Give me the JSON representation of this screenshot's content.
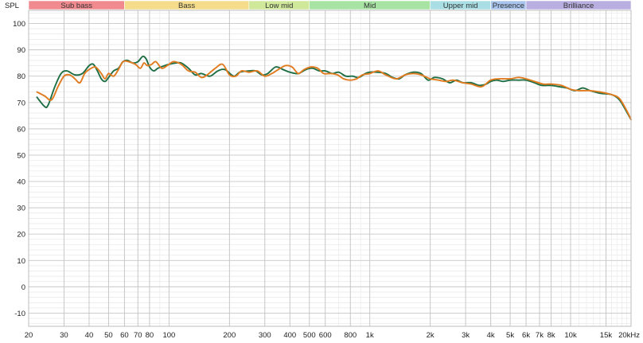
{
  "chart_data": {
    "type": "line",
    "title": "",
    "ylabel": "SPL",
    "xlabel": "",
    "x_unit_suffix": "Hz",
    "x_scale": "log",
    "xlim": [
      20,
      20000
    ],
    "ylim": [
      -15,
      105
    ],
    "grid": true,
    "y_ticks": [
      100,
      90,
      80,
      70,
      60,
      50,
      40,
      30,
      20,
      10,
      0,
      -10
    ],
    "x_ticks": [
      {
        "value": 20,
        "label": "20"
      },
      {
        "value": 30,
        "label": "30"
      },
      {
        "value": 40,
        "label": "40"
      },
      {
        "value": 50,
        "label": "50"
      },
      {
        "value": 60,
        "label": "60"
      },
      {
        "value": 70,
        "label": "70"
      },
      {
        "value": 80,
        "label": "80"
      },
      {
        "value": 100,
        "label": "100"
      },
      {
        "value": 200,
        "label": "200"
      },
      {
        "value": 300,
        "label": "300"
      },
      {
        "value": 400,
        "label": "400"
      },
      {
        "value": 500,
        "label": "500"
      },
      {
        "value": 600,
        "label": "600"
      },
      {
        "value": 800,
        "label": "800"
      },
      {
        "value": 1000,
        "label": "1k"
      },
      {
        "value": 2000,
        "label": "2k"
      },
      {
        "value": 3000,
        "label": "3k"
      },
      {
        "value": 4000,
        "label": "4k"
      },
      {
        "value": 5000,
        "label": "5k"
      },
      {
        "value": 6000,
        "label": "6k"
      },
      {
        "value": 7000,
        "label": "7k"
      },
      {
        "value": 8000,
        "label": "8k"
      },
      {
        "value": 10000,
        "label": "10k"
      },
      {
        "value": 15000,
        "label": "15k"
      },
      {
        "value": 20000,
        "label": "20k"
      }
    ],
    "bands": [
      {
        "label": "Sub bass",
        "from": 20,
        "to": 60,
        "color": "#f08a8f"
      },
      {
        "label": "Bass",
        "from": 60,
        "to": 250,
        "color": "#f5dc8a"
      },
      {
        "label": "Low mid",
        "from": 250,
        "to": 500,
        "color": "#cfe89a"
      },
      {
        "label": "Mid",
        "from": 500,
        "to": 2000,
        "color": "#a7e3a3"
      },
      {
        "label": "Upper mid",
        "from": 2000,
        "to": 4000,
        "color": "#a9dfe4"
      },
      {
        "label": "Presence",
        "from": 4000,
        "to": 6000,
        "color": "#a9c4ec"
      },
      {
        "label": "Brilliance",
        "from": 6000,
        "to": 20000,
        "color": "#b9aee0"
      }
    ],
    "series": [
      {
        "color": "#1e6e45",
        "points": [
          [
            22,
            72
          ],
          [
            24,
            68.5
          ],
          [
            25,
            69
          ],
          [
            27,
            76
          ],
          [
            29,
            81
          ],
          [
            31,
            82
          ],
          [
            34,
            80.5
          ],
          [
            37,
            81
          ],
          [
            40,
            84
          ],
          [
            42,
            84.5
          ],
          [
            44,
            82
          ],
          [
            46,
            79
          ],
          [
            48,
            78
          ],
          [
            50,
            79.5
          ],
          [
            53,
            82
          ],
          [
            56,
            83
          ],
          [
            59,
            85.5
          ],
          [
            62,
            86
          ],
          [
            66,
            85
          ],
          [
            70,
            85.5
          ],
          [
            74,
            87.5
          ],
          [
            77,
            86.5
          ],
          [
            80,
            83.5
          ],
          [
            84,
            82
          ],
          [
            88,
            83
          ],
          [
            95,
            84
          ],
          [
            100,
            84.5
          ],
          [
            108,
            85
          ],
          [
            115,
            85
          ],
          [
            125,
            83
          ],
          [
            135,
            80.5
          ],
          [
            145,
            81
          ],
          [
            160,
            80
          ],
          [
            175,
            82
          ],
          [
            190,
            82.5
          ],
          [
            210,
            80
          ],
          [
            225,
            81.5
          ],
          [
            250,
            82
          ],
          [
            270,
            82
          ],
          [
            290,
            80.5
          ],
          [
            310,
            81
          ],
          [
            340,
            83.5
          ],
          [
            370,
            82.5
          ],
          [
            400,
            81.5
          ],
          [
            440,
            81
          ],
          [
            480,
            82.5
          ],
          [
            520,
            83
          ],
          [
            560,
            82
          ],
          [
            600,
            82
          ],
          [
            650,
            81
          ],
          [
            700,
            81.5
          ],
          [
            760,
            80
          ],
          [
            820,
            80
          ],
          [
            880,
            79.5
          ],
          [
            950,
            81
          ],
          [
            1000,
            81.5
          ],
          [
            1100,
            81.5
          ],
          [
            1200,
            81
          ],
          [
            1300,
            79.5
          ],
          [
            1400,
            79
          ],
          [
            1500,
            80.5
          ],
          [
            1650,
            81.5
          ],
          [
            1800,
            81
          ],
          [
            1950,
            78.5
          ],
          [
            2100,
            79.5
          ],
          [
            2300,
            79
          ],
          [
            2500,
            77.5
          ],
          [
            2700,
            78.5
          ],
          [
            2900,
            77.5
          ],
          [
            3200,
            77.5
          ],
          [
            3500,
            76.5
          ],
          [
            3800,
            77
          ],
          [
            4000,
            78
          ],
          [
            4300,
            78.5
          ],
          [
            4600,
            78
          ],
          [
            5000,
            78.5
          ],
          [
            5500,
            78.5
          ],
          [
            6000,
            78.5
          ],
          [
            6600,
            77.5
          ],
          [
            7200,
            76.5
          ],
          [
            8000,
            76.5
          ],
          [
            8800,
            76
          ],
          [
            9600,
            75.5
          ],
          [
            10500,
            74.5
          ],
          [
            11500,
            75.5
          ],
          [
            12500,
            74.5
          ],
          [
            14000,
            73.5
          ],
          [
            16000,
            73
          ],
          [
            17500,
            71
          ],
          [
            19000,
            66.5
          ],
          [
            20000,
            63.5
          ]
        ]
      },
      {
        "color": "#e07b1f",
        "points": [
          [
            22,
            74
          ],
          [
            24,
            72.5
          ],
          [
            26,
            71
          ],
          [
            28,
            76
          ],
          [
            30,
            80
          ],
          [
            32,
            80.5
          ],
          [
            34,
            79
          ],
          [
            36,
            77.5
          ],
          [
            38,
            81
          ],
          [
            40,
            82.5
          ],
          [
            43,
            83.5
          ],
          [
            46,
            81
          ],
          [
            48,
            79
          ],
          [
            50,
            81
          ],
          [
            53,
            80
          ],
          [
            56,
            82.5
          ],
          [
            59,
            85.5
          ],
          [
            63,
            85.5
          ],
          [
            68,
            84.5
          ],
          [
            72,
            83
          ],
          [
            75,
            85
          ],
          [
            78,
            84
          ],
          [
            82,
            84.5
          ],
          [
            86,
            85.5
          ],
          [
            92,
            83
          ],
          [
            98,
            84
          ],
          [
            105,
            85.5
          ],
          [
            115,
            84.5
          ],
          [
            125,
            82
          ],
          [
            135,
            81.5
          ],
          [
            145,
            79.5
          ],
          [
            155,
            80.5
          ],
          [
            170,
            83
          ],
          [
            185,
            84.5
          ],
          [
            200,
            80.5
          ],
          [
            215,
            80
          ],
          [
            230,
            82
          ],
          [
            250,
            81.5
          ],
          [
            275,
            82
          ],
          [
            300,
            80
          ],
          [
            325,
            81
          ],
          [
            350,
            82.5
          ],
          [
            380,
            84
          ],
          [
            410,
            83.5
          ],
          [
            440,
            81
          ],
          [
            470,
            82.5
          ],
          [
            510,
            83.5
          ],
          [
            550,
            83
          ],
          [
            590,
            81
          ],
          [
            640,
            81
          ],
          [
            690,
            80.5
          ],
          [
            740,
            79
          ],
          [
            800,
            78.5
          ],
          [
            860,
            79
          ],
          [
            920,
            80.5
          ],
          [
            1000,
            81
          ],
          [
            1100,
            82
          ],
          [
            1200,
            80.5
          ],
          [
            1350,
            79
          ],
          [
            1500,
            80.5
          ],
          [
            1650,
            81
          ],
          [
            1800,
            80.5
          ],
          [
            2000,
            79
          ],
          [
            2200,
            78.5
          ],
          [
            2400,
            78
          ],
          [
            2600,
            78.5
          ],
          [
            2900,
            77.5
          ],
          [
            3200,
            77
          ],
          [
            3600,
            76
          ],
          [
            4000,
            78.5
          ],
          [
            4400,
            79
          ],
          [
            5000,
            79
          ],
          [
            5500,
            79.5
          ],
          [
            6000,
            79
          ],
          [
            6600,
            78
          ],
          [
            7300,
            77
          ],
          [
            8000,
            77
          ],
          [
            9000,
            76.5
          ],
          [
            10000,
            75
          ],
          [
            11000,
            74.5
          ],
          [
            12500,
            74.5
          ],
          [
            14000,
            74
          ],
          [
            16000,
            73
          ],
          [
            17500,
            71.5
          ],
          [
            19000,
            67
          ],
          [
            20000,
            63.5
          ]
        ]
      }
    ]
  }
}
